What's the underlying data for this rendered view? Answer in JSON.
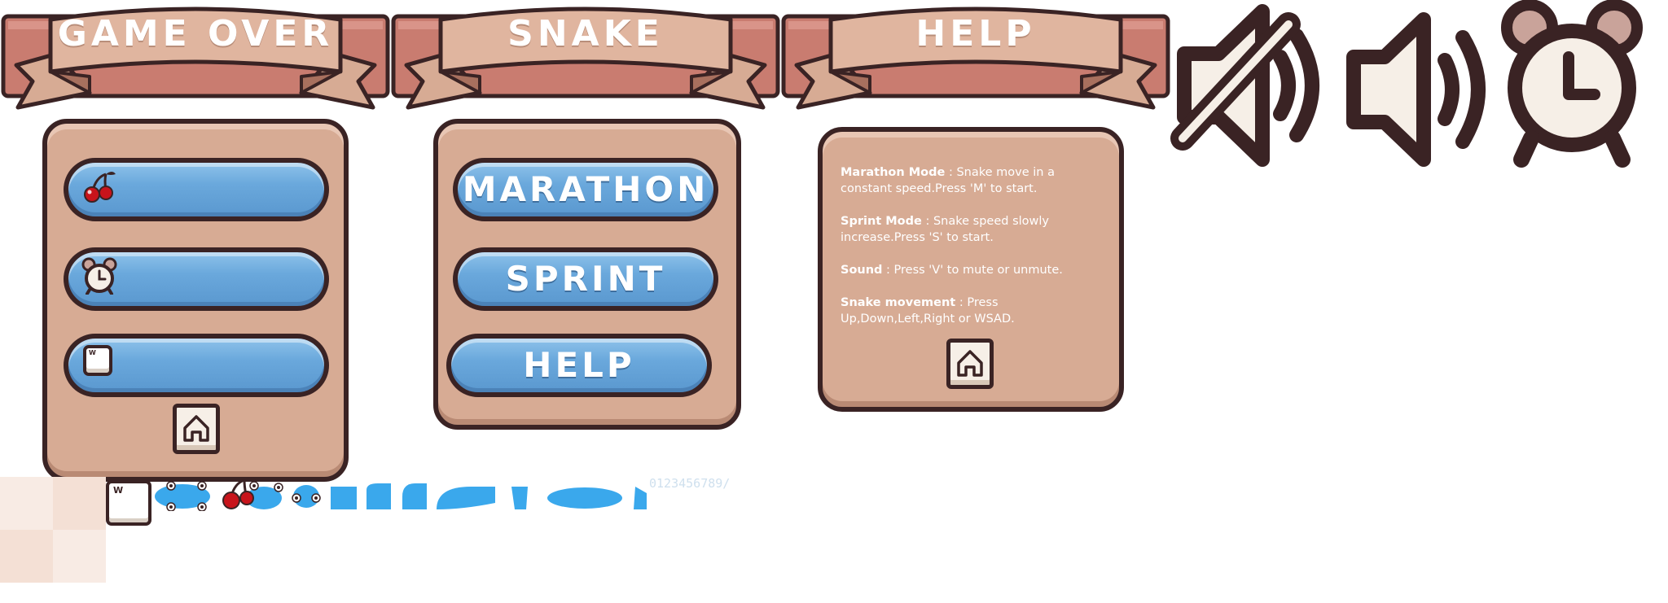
{
  "banners": {
    "game_over": "GAME OVER",
    "snake": "SNAKE",
    "help": "HELP"
  },
  "menu": {
    "marathon": "MARATHON",
    "sprint": "SPRINT",
    "help": "HELP"
  },
  "game_over_panel": {
    "rows": [
      {
        "icon": "cherry-icon",
        "value": ""
      },
      {
        "icon": "alarm-clock-icon",
        "value": ""
      },
      {
        "icon": "w-key-icon",
        "value": ""
      }
    ],
    "key_letter": "W"
  },
  "help_panel": {
    "entries": [
      {
        "title": "Marathon Mode",
        "text": " : Snake move in a constant speed.Press 'M' to start."
      },
      {
        "title": "Sprint Mode",
        "text": " : Snake speed slowly increase.Press 'S' to start."
      },
      {
        "title": "Sound",
        "text": " : Press 'V' to mute or unmute."
      },
      {
        "title": "Snake movement",
        "text": " : Press Up,Down,Left,Right or WSAD."
      }
    ]
  },
  "icons": [
    "sound-muted-icon",
    "sound-on-icon",
    "alarm-clock-icon",
    "home-icon",
    "cherry-icon"
  ],
  "sprite_strip": {
    "key_letter": "W",
    "digits": "0123456789/"
  },
  "colors": {
    "panel": "#d7ab94",
    "outline": "#3a2324",
    "ribbon": "#d7ab94",
    "ribbon_back": "#c97c70",
    "button_blue": "#6aa8dc",
    "snake_blue": "#3aa8ec",
    "cherry_red": "#c8141b"
  }
}
